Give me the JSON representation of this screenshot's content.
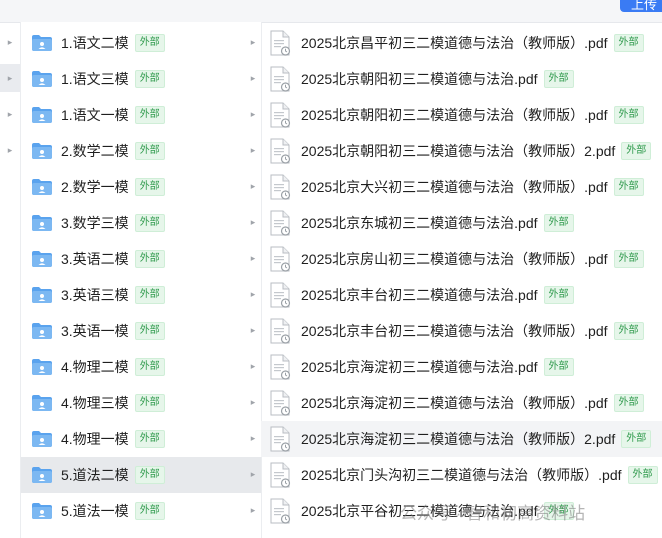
{
  "toolbar": {
    "upload_label": "上传"
  },
  "badge_text": "外部",
  "folders": [
    {
      "name": "1.语文二模"
    },
    {
      "name": "1.语文三模"
    },
    {
      "name": "1.语文一模"
    },
    {
      "name": "2.数学二模"
    },
    {
      "name": "2.数学一模"
    },
    {
      "name": "3.数学三模"
    },
    {
      "name": "3.英语二模"
    },
    {
      "name": "3.英语三模"
    },
    {
      "name": "3.英语一模"
    },
    {
      "name": "4.物理二模"
    },
    {
      "name": "4.物理三模"
    },
    {
      "name": "4.物理一模"
    },
    {
      "name": "5.道法二模",
      "selected": true
    },
    {
      "name": "5.道法一模"
    }
  ],
  "files": [
    {
      "name": "2025北京昌平初三二模道德与法治（教师版）.pdf"
    },
    {
      "name": "2025北京朝阳初三二模道德与法治.pdf"
    },
    {
      "name": "2025北京朝阳初三二模道德与法治（教师版）.pdf"
    },
    {
      "name": "2025北京朝阳初三二模道德与法治（教师版）2.pdf"
    },
    {
      "name": "2025北京大兴初三二模道德与法治（教师版）.pdf"
    },
    {
      "name": "2025北京东城初三二模道德与法治.pdf"
    },
    {
      "name": "2025北京房山初三二模道德与法治（教师版）.pdf"
    },
    {
      "name": "2025北京丰台初三二模道德与法治.pdf"
    },
    {
      "name": "2025北京丰台初三二模道德与法治（教师版）.pdf"
    },
    {
      "name": "2025北京海淀初三二模道德与法治.pdf"
    },
    {
      "name": "2025北京海淀初三二模道德与法治（教师版）.pdf"
    },
    {
      "name": "2025北京海淀初三二模道德与法治（教师版）2.pdf",
      "hover": true
    },
    {
      "name": "2025北京门头沟初三二模道德与法治（教师版）.pdf"
    },
    {
      "name": "2025北京平谷初三二模道德与法治.pdf"
    }
  ],
  "watermark": {
    "text": "公众号 · 智和初高资料站"
  },
  "colors": {
    "accent": "#3a7bf4",
    "folder": "#5aa3ee",
    "badge_text": "#2f9a4c"
  }
}
